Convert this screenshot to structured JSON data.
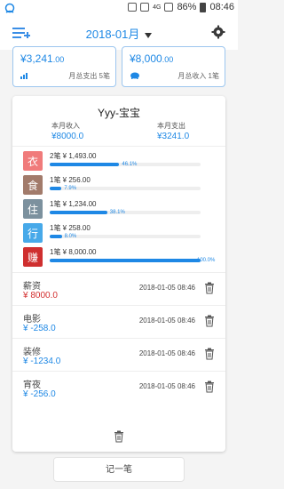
{
  "status_bar": {
    "battery": "86%",
    "time": "08:46",
    "network": "4G"
  },
  "header": {
    "month": "2018-01月",
    "icons": [
      "add-entry-icon",
      "gear-icon"
    ]
  },
  "summary": {
    "expense_card": {
      "amount_main": "¥3,241",
      "amount_cents": ".00",
      "note": "月总支出 5笔",
      "icon": "bar-chart-icon"
    },
    "income_card": {
      "amount_main": "¥8,000",
      "amount_cents": ".00",
      "note": "月总收入 1笔",
      "icon": "piggy-bank-icon"
    }
  },
  "panel": {
    "user": "Yyy-宝宝",
    "income_label": "本月收入",
    "income_value": "¥8000.0",
    "expense_label": "本月支出",
    "expense_value": "¥3241.0",
    "categories": [
      {
        "char": "衣",
        "text": "2笔 ¥ 1,493.00",
        "pct": "46.1%",
        "color": "#f07b7b",
        "fill": 0.461
      },
      {
        "char": "食",
        "text": "1笔 ¥ 256.00",
        "pct": "7.9%",
        "color": "#a27b6b",
        "fill": 0.079
      },
      {
        "char": "住",
        "text": "1笔 ¥ 1,234.00",
        "pct": "38.1%",
        "color": "#7c919e",
        "fill": 0.381
      },
      {
        "char": "行",
        "text": "1笔 ¥ 258.00",
        "pct": "8.0%",
        "color": "#47a9e9",
        "fill": 0.08
      },
      {
        "char": "赚",
        "text": "1笔 ¥ 8,000.00",
        "pct": "100.0%",
        "color": "#cf2f2f",
        "fill": 1.0
      }
    ],
    "records": [
      {
        "name": "薪资",
        "amount": "¥ 8000.0",
        "time": "2018-01-05 08:46",
        "color": "#d32f2f"
      },
      {
        "name": "电影",
        "amount": "¥ -258.0",
        "time": "2018-01-05 08:46",
        "color": "#1e88e5"
      },
      {
        "name": "装修",
        "amount": "¥ -1234.0",
        "time": "2018-01-05 08:46",
        "color": "#1e88e5"
      },
      {
        "name": "宵夜",
        "amount": "¥ -256.0",
        "time": "2018-01-05 08:46",
        "color": "#1e88e5"
      }
    ]
  },
  "footer": {
    "record_button": "记一笔"
  }
}
